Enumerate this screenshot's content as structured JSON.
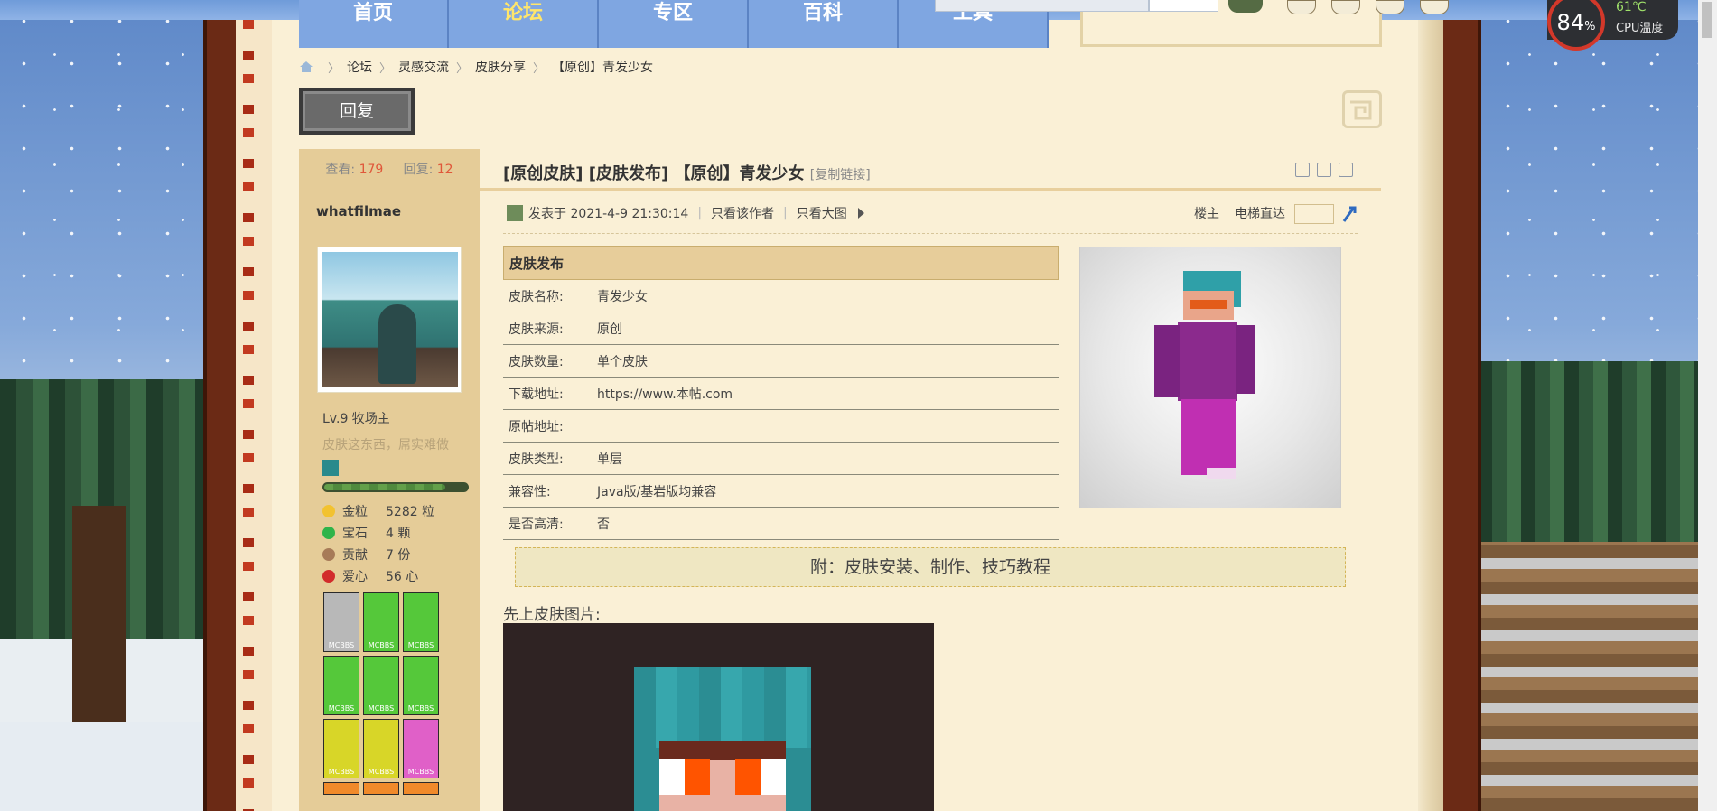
{
  "topnav": {
    "items": [
      {
        "label": "首页",
        "active": false
      },
      {
        "label": "论坛",
        "active": true
      },
      {
        "label": "专区",
        "active": false
      },
      {
        "label": "百科",
        "active": false
      },
      {
        "label": "工具",
        "active": false
      }
    ]
  },
  "cpu_widget": {
    "usage": "84",
    "unit": "%",
    "temp": "61℃",
    "label": "CPU温度"
  },
  "breadcrumb": {
    "items": [
      "论坛",
      "灵感交流",
      "皮肤分享",
      "【原创】青发少女"
    ],
    "separator": "〉"
  },
  "reply_button": {
    "label": "回复"
  },
  "user": {
    "views_label": "查看:",
    "views": "179",
    "replies_label": "回复:",
    "replies": "12",
    "name": "whatfilmae",
    "level": "Lv.9 牧场主",
    "motto": "皮肤这东西，屌实难做",
    "xp_fraction": 0.85,
    "resources": [
      {
        "icon": "gold-nugget-icon",
        "label": "金粒",
        "value": "5282 粒",
        "color": "#f2c230"
      },
      {
        "icon": "emerald-icon",
        "label": "宝石",
        "value": "4 颗",
        "color": "#2fb44a"
      },
      {
        "icon": "cookie-icon",
        "label": "贡献",
        "value": "7 份",
        "color": "#a77b58"
      },
      {
        "icon": "apple-icon",
        "label": "爱心",
        "value": "56 心",
        "color": "#d22b2b"
      }
    ],
    "medals": [
      {
        "label": "MCBBS",
        "bg": "#b8b8b8",
        "icon": "fire-medal"
      },
      {
        "label": "MCBBS",
        "bg": "#55c83a",
        "icon": "map-medal"
      },
      {
        "label": "MCBBS",
        "bg": "#55c83a",
        "icon": "block-medal"
      },
      {
        "label": "MCBBS",
        "bg": "#55c83a",
        "icon": "phone-medal"
      },
      {
        "label": "MCBBS",
        "bg": "#55c83a",
        "icon": "book-medal"
      },
      {
        "label": "MCBBS",
        "bg": "#55c83a",
        "icon": "redstone-medal"
      },
      {
        "label": "MCBBS",
        "bg": "#d8d628",
        "icon": "pickaxe-medal"
      },
      {
        "label": "MCBBS",
        "bg": "#d8d628",
        "icon": "pickaxe-medal-2"
      },
      {
        "label": "MCBBS",
        "bg": "#e060c8",
        "icon": "apple-medal"
      }
    ]
  },
  "post": {
    "title": "[原创皮肤] [皮肤发布] 【原创】青发少女",
    "copy_link": "[复制链接]",
    "posted_at": "发表于 2021-4-9 21:30:14",
    "only_author": "只看该作者",
    "big_image": "只看大图",
    "floor": "楼主",
    "elevator": "电梯直达",
    "table_title": "皮肤发布",
    "table": [
      {
        "k": "皮肤名称:",
        "v": "青发少女"
      },
      {
        "k": "皮肤来源:",
        "v": "原创"
      },
      {
        "k": "皮肤数量:",
        "v": "单个皮肤"
      },
      {
        "k": "下载地址:",
        "v": "https://www.本帖.com"
      },
      {
        "k": "原帖地址:",
        "v": ""
      },
      {
        "k": "皮肤类型:",
        "v": "单层"
      },
      {
        "k": "兼容性:",
        "v": "Java版/基岩版均兼容"
      },
      {
        "k": "是否高清:",
        "v": "否"
      }
    ],
    "attach_bar": "附：皮肤安装、制作、技巧教程",
    "first_text": "先上皮肤图片:"
  },
  "colors": {
    "accent": "#e0573a",
    "paper": "#faf0d6",
    "panel": "#e5cc98",
    "nav": "#7fa6e1"
  }
}
